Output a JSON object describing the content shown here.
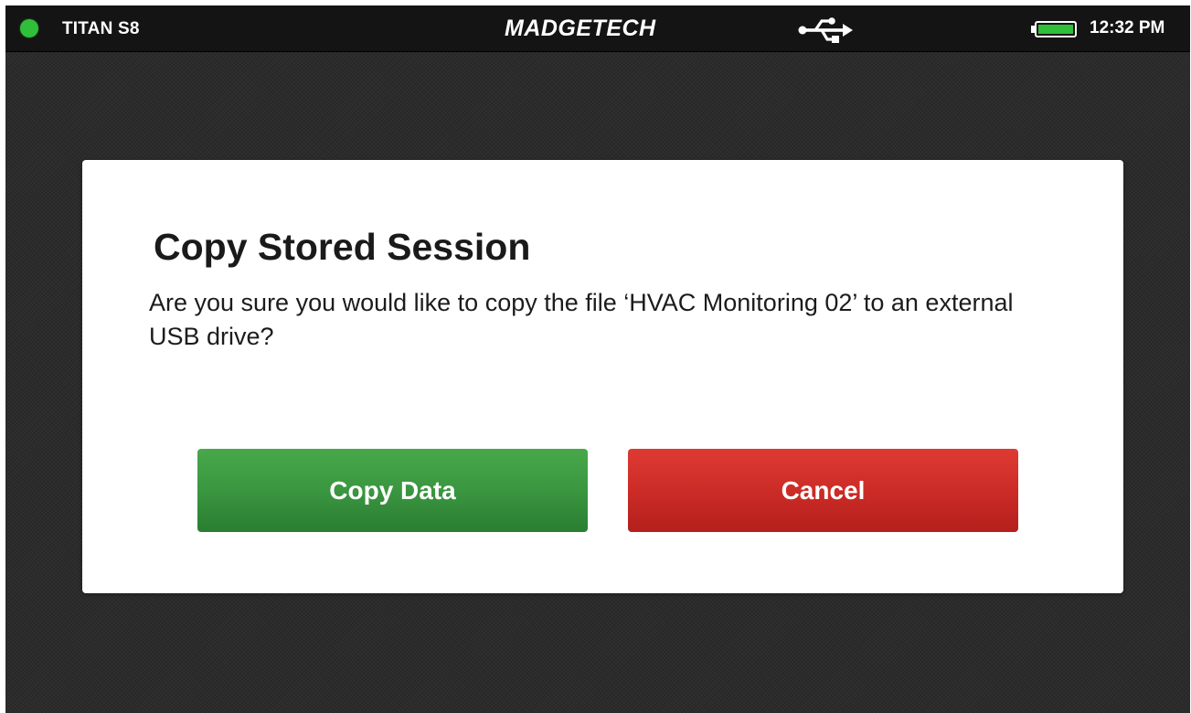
{
  "status_bar": {
    "device_name": "TITAN S8",
    "brand": "MADGETECH",
    "time": "12:32 PM",
    "indicator_icon": "status-indicator-icon",
    "usb_icon": "usb-icon",
    "battery_icon": "battery-icon",
    "colors": {
      "indicator": "#2fbf3a",
      "battery": "#2fbf3a"
    }
  },
  "dialog": {
    "title": "Copy Stored Session",
    "message": "Are you sure you would like to copy the file ‘HVAC Monitoring 02’ to an external USB drive?",
    "buttons": {
      "confirm_label": "Copy Data",
      "cancel_label": "Cancel"
    },
    "colors": {
      "confirm": "#3a9640",
      "cancel": "#cc2c27"
    }
  }
}
